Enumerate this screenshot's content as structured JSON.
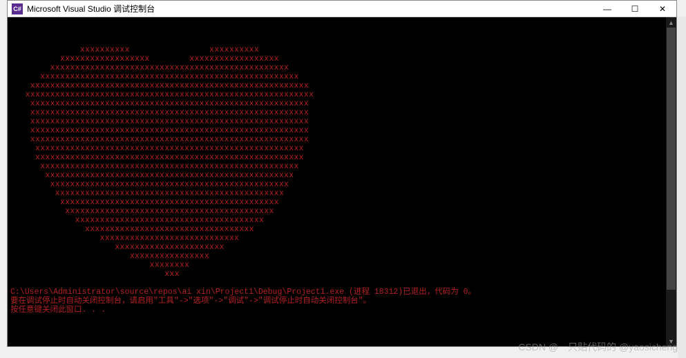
{
  "titlebar": {
    "icon_label": "C#",
    "title": "Microsoft Visual Studio 调试控制台",
    "minimize": "—",
    "maximize": "☐",
    "close": "✕"
  },
  "heart": {
    "lines": [
      "              xxxxxxxxxx                xxxxxxxxxx",
      "          xxxxxxxxxxxxxxxxxx        xxxxxxxxxxxxxxxxxx",
      "        xxxxxxxxxxxxxxxxxxxxxxxxxxxxxxxxxxxxxxxxxxxxxxxx",
      "      xxxxxxxxxxxxxxxxxxxxxxxxxxxxxxxxxxxxxxxxxxxxxxxxxxxx",
      "    xxxxxxxxxxxxxxxxxxxxxxxxxxxxxxxxxxxxxxxxxxxxxxxxxxxxxxxx",
      "   xxxxxxxxxxxxxxxxxxxxxxxxxxxxxxxxxxxxxxxxxxxxxxxxxxxxxxxxxx",
      "    xxxxxxxxxxxxxxxxxxxxxxxxxxxxxxxxxxxxxxxxxxxxxxxxxxxxxxxx",
      "    xxxxxxxxxxxxxxxxxxxxxxxxxxxxxxxxxxxxxxxxxxxxxxxxxxxxxxxx",
      "    xxxxxxxxxxxxxxxxxxxxxxxxxxxxxxxxxxxxxxxxxxxxxxxxxxxxxxxx",
      "    xxxxxxxxxxxxxxxxxxxxxxxxxxxxxxxxxxxxxxxxxxxxxxxxxxxxxxxx",
      "    xxxxxxxxxxxxxxxxxxxxxxxxxxxxxxxxxxxxxxxxxxxxxxxxxxxxxxxx",
      "     xxxxxxxxxxxxxxxxxxxxxxxxxxxxxxxxxxxxxxxxxxxxxxxxxxxxxx",
      "     xxxxxxxxxxxxxxxxxxxxxxxxxxxxxxxxxxxxxxxxxxxxxxxxxxxxxx",
      "      xxxxxxxxxxxxxxxxxxxxxxxxxxxxxxxxxxxxxxxxxxxxxxxxxxxx",
      "       xxxxxxxxxxxxxxxxxxxxxxxxxxxxxxxxxxxxxxxxxxxxxxxxxx",
      "        xxxxxxxxxxxxxxxxxxxxxxxxxxxxxxxxxxxxxxxxxxxxxxxx",
      "         xxxxxxxxxxxxxxxxxxxxxxxxxxxxxxxxxxxxxxxxxxxxxx",
      "          xxxxxxxxxxxxxxxxxxxxxxxxxxxxxxxxxxxxxxxxxxxx",
      "           xxxxxxxxxxxxxxxxxxxxxxxxxxxxxxxxxxxxxxxxxx",
      "             xxxxxxxxxxxxxxxxxxxxxxxxxxxxxxxxxxxxxx",
      "               xxxxxxxxxxxxxxxxxxxxxxxxxxxxxxxxxx",
      "                  xxxxxxxxxxxxxxxxxxxxxxxxxxxx",
      "                     xxxxxxxxxxxxxxxxxxxxxx",
      "                        xxxxxxxxxxxxxxxx",
      "                            xxxxxxxx",
      "                               xxx"
    ]
  },
  "output": {
    "line1": "C:\\Users\\Administrator\\source\\repos\\ai xin\\Project1\\Debug\\Project1.exe (进程 18312)已退出，代码为 0。",
    "line2": "要在调试停止时自动关闭控制台，请启用\"工具\"->\"选项\"->\"调试\"->\"调试停止时自动关闭控制台\"。",
    "line3": "按任意键关闭此窗口. . ."
  },
  "watermark": "CSDN @一只贴代码的 @yaosicheng"
}
